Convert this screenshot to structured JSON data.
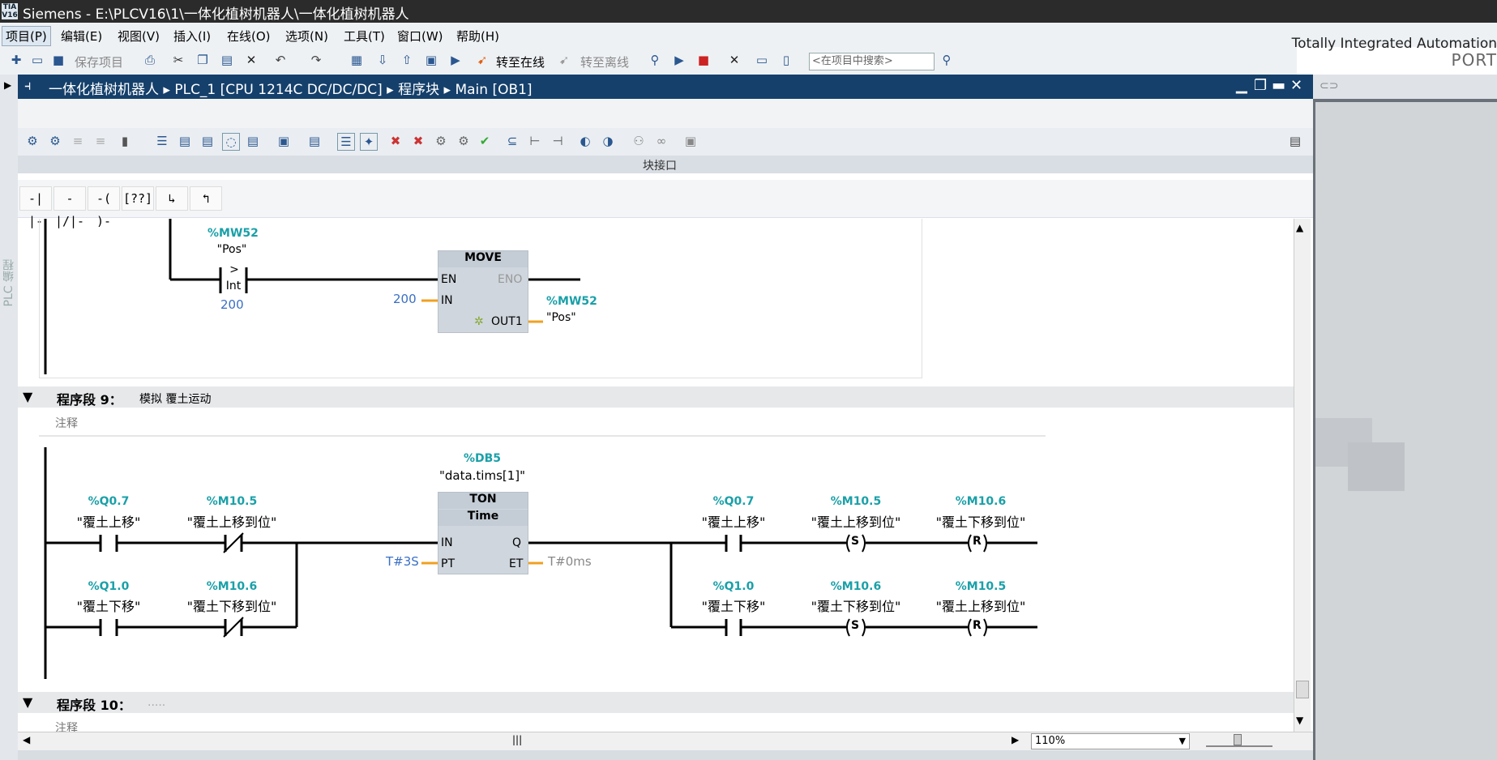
{
  "title": {
    "logo": "TIA V16",
    "text": "Siemens  -  E:\\PLCV16\\1\\一体化植树机器人\\一体化植树机器人"
  },
  "menu": [
    "项目(P)",
    "编辑(E)",
    "视图(V)",
    "插入(I)",
    "在线(O)",
    "选项(N)",
    "工具(T)",
    "窗口(W)",
    "帮助(H)"
  ],
  "brand": {
    "line1": "Totally Integrated Automation",
    "line2": "PORT"
  },
  "toolbar": {
    "save": "保存项目",
    "online": "转至在线",
    "offline": "转至离线",
    "search_placeholder": "<在项目中搜索>"
  },
  "breadcrumb": [
    "一体化植树机器人",
    "PLC_1 [CPU 1214C DC/DC/DC]",
    "程序块",
    "Main [OB1]"
  ],
  "left_sidebar_label": "PLC 编程",
  "interface_label": "块接口",
  "zoom": "110%",
  "network8": {
    "cmp_tag": "%MW52",
    "cmp_name": "\"Pos\"",
    "cmp_op": ">",
    "cmp_type": "Int",
    "cmp_val": "200",
    "move_title": "MOVE",
    "en": "EN",
    "eno": "ENO",
    "in": "IN",
    "out": "OUT1",
    "in_val": "200",
    "out_tag": "%MW52",
    "out_name": "\"Pos\""
  },
  "network9": {
    "title": "程序段 9：",
    "comment": "模拟 覆土运动",
    "comment_label": "注释",
    "db_tag": "%DB5",
    "db_name": "\"data.tims[1]\"",
    "ton": "TON",
    "time": "Time",
    "in": "IN",
    "q": "Q",
    "pt": "PT",
    "et": "ET",
    "pt_val": "T#3S",
    "et_val": "T#0ms",
    "contacts": [
      {
        "tag": "%Q0.7",
        "name": "\"覆土上移\""
      },
      {
        "tag": "%M10.5",
        "name": "\"覆土上移到位\""
      },
      {
        "tag": "%Q1.0",
        "name": "\"覆土下移\""
      },
      {
        "tag": "%M10.6",
        "name": "\"覆土下移到位\""
      }
    ],
    "outputs": [
      {
        "tag": "%Q0.7",
        "name": "\"覆土上移\""
      },
      {
        "tag": "%M10.5",
        "name": "\"覆土上移到位\"",
        "coil": "S"
      },
      {
        "tag": "%M10.6",
        "name": "\"覆土下移到位\"",
        "coil": "R"
      },
      {
        "tag": "%Q1.0",
        "name": "\"覆土下移\""
      },
      {
        "tag": "%M10.6",
        "name": "\"覆土下移到位\"",
        "coil": "S"
      },
      {
        "tag": "%M10.5",
        "name": "\"覆土上移到位\"",
        "coil": "R"
      }
    ]
  },
  "network10": {
    "title": "程序段 10：",
    "comment": ".....",
    "comment_label": "注释"
  }
}
